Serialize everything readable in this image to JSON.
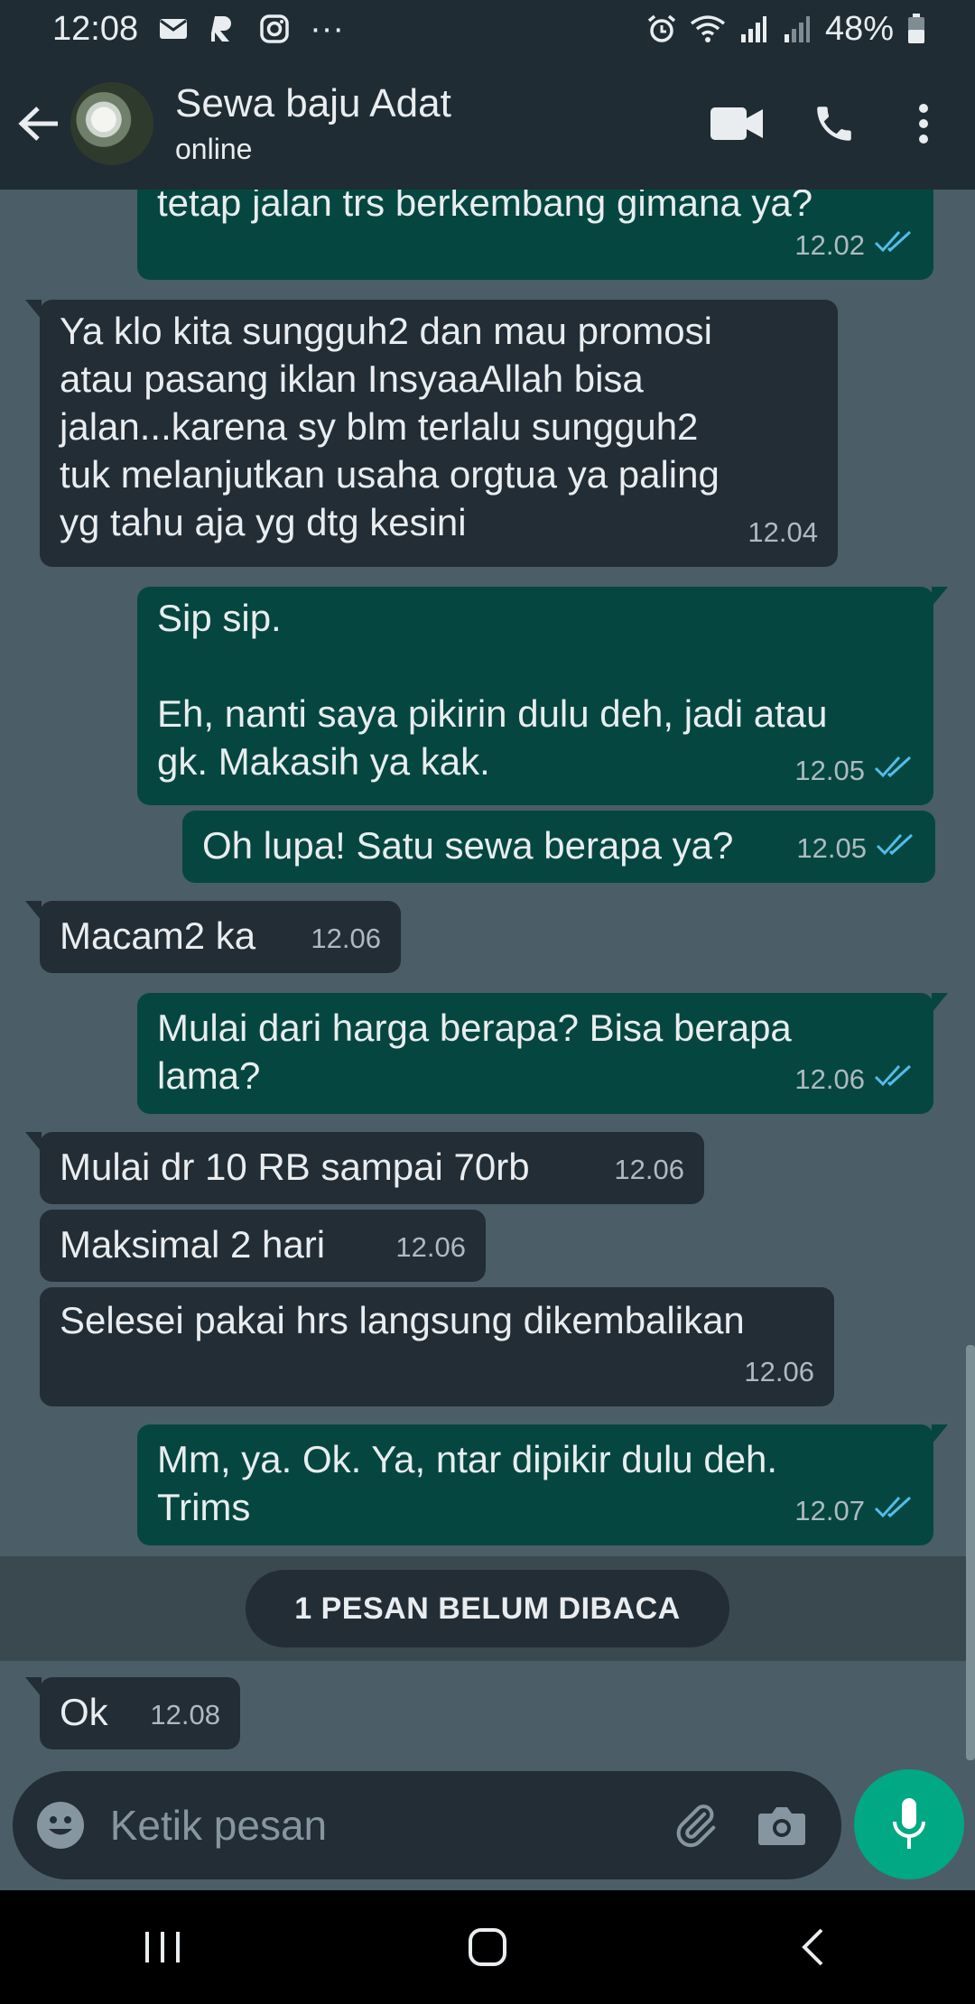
{
  "status_bar": {
    "time": "12:08",
    "dots": "···",
    "battery": "48%"
  },
  "header": {
    "contact_name": "Sewa baju Adat",
    "status": "online"
  },
  "messages": [
    {
      "dir": "out",
      "text": "tetap jalan trs berkembang gimana ya?",
      "time": "12.02",
      "read": true
    },
    {
      "dir": "in",
      "text": "Ya klo kita sungguh2 dan mau promosi\natau pasang iklan InsyaaAllah bisa\njalan...karena sy blm terlalu sungguh2\ntuk melanjutkan usaha orgtua ya paling\nyg tahu aja yg dtg kesini",
      "time": "12.04"
    },
    {
      "dir": "out",
      "text": "Sip sip.\n\nEh, nanti saya pikirin dulu deh, jadi atau\ngk. Makasih ya kak.",
      "time": "12.05",
      "read": true
    },
    {
      "dir": "out",
      "text": "Oh lupa! Satu sewa berapa ya?",
      "time": "12.05",
      "read": true
    },
    {
      "dir": "in",
      "text": "Macam2 ka",
      "time": "12.06"
    },
    {
      "dir": "out",
      "text": "Mulai dari harga berapa? Bisa berapa\nlama?",
      "time": "12.06",
      "read": true
    },
    {
      "dir": "in",
      "text": "Mulai dr 10 RB sampai 70rb",
      "time": "12.06"
    },
    {
      "dir": "in",
      "text": "Maksimal 2 hari",
      "time": "12.06"
    },
    {
      "dir": "in",
      "text": "Selesei pakai hrs langsung dikembalikan",
      "time": "12.06"
    },
    {
      "dir": "out",
      "text": "Mm, ya. Ok. Ya, ntar dipikir dulu deh.\nTrims",
      "time": "12.07",
      "read": true
    },
    {
      "dir": "in",
      "text": "Ok",
      "time": "12.08"
    }
  ],
  "unread_banner": "1 PESAN BELUM DIBACA",
  "composer": {
    "placeholder": "Ketik pesan"
  },
  "colors": {
    "accent": "#00a884",
    "outgoing_bubble": "#054740",
    "incoming_bubble": "#232d36",
    "read_tick": "#53bdeb"
  }
}
